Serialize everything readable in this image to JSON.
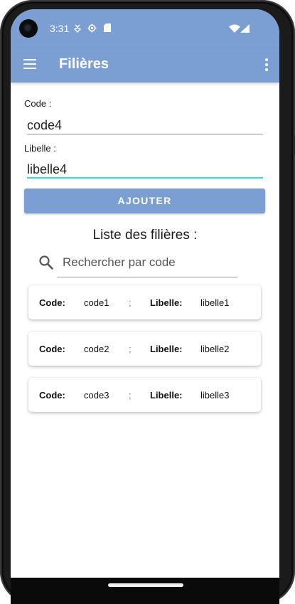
{
  "status_bar": {
    "time": "3:31",
    "icons": [
      "usb-debug-icon",
      "settings-icon",
      "sd-card-icon",
      "wifi-icon",
      "signal-icon"
    ]
  },
  "app_bar": {
    "title": "Filières",
    "menu_icon": "hamburger-menu-icon",
    "overflow_icon": "more-vert-icon"
  },
  "form": {
    "code_label": "Code :",
    "code_value": "code4",
    "libelle_label": "Libelle  :",
    "libelle_value": "libelle4",
    "add_button": "AJOUTER"
  },
  "list": {
    "title": "Liste des filières :",
    "search_placeholder": "Rechercher par code",
    "items": [
      {
        "code_key": "Code:",
        "code": "code1",
        "sep": ";",
        "libelle_key": "Libelle:",
        "libelle": "libelle1"
      },
      {
        "code_key": "Code:",
        "code": "code2",
        "sep": ";",
        "libelle_key": "Libelle:",
        "libelle": "libelle2"
      },
      {
        "code_key": "Code:",
        "code": "code3",
        "sep": ";",
        "libelle_key": "Libelle:",
        "libelle": "libelle3"
      }
    ]
  },
  "colors": {
    "primary": "#7b9fd2",
    "active_underline": "#2ee6c4",
    "frame": "#1b1b1c"
  }
}
